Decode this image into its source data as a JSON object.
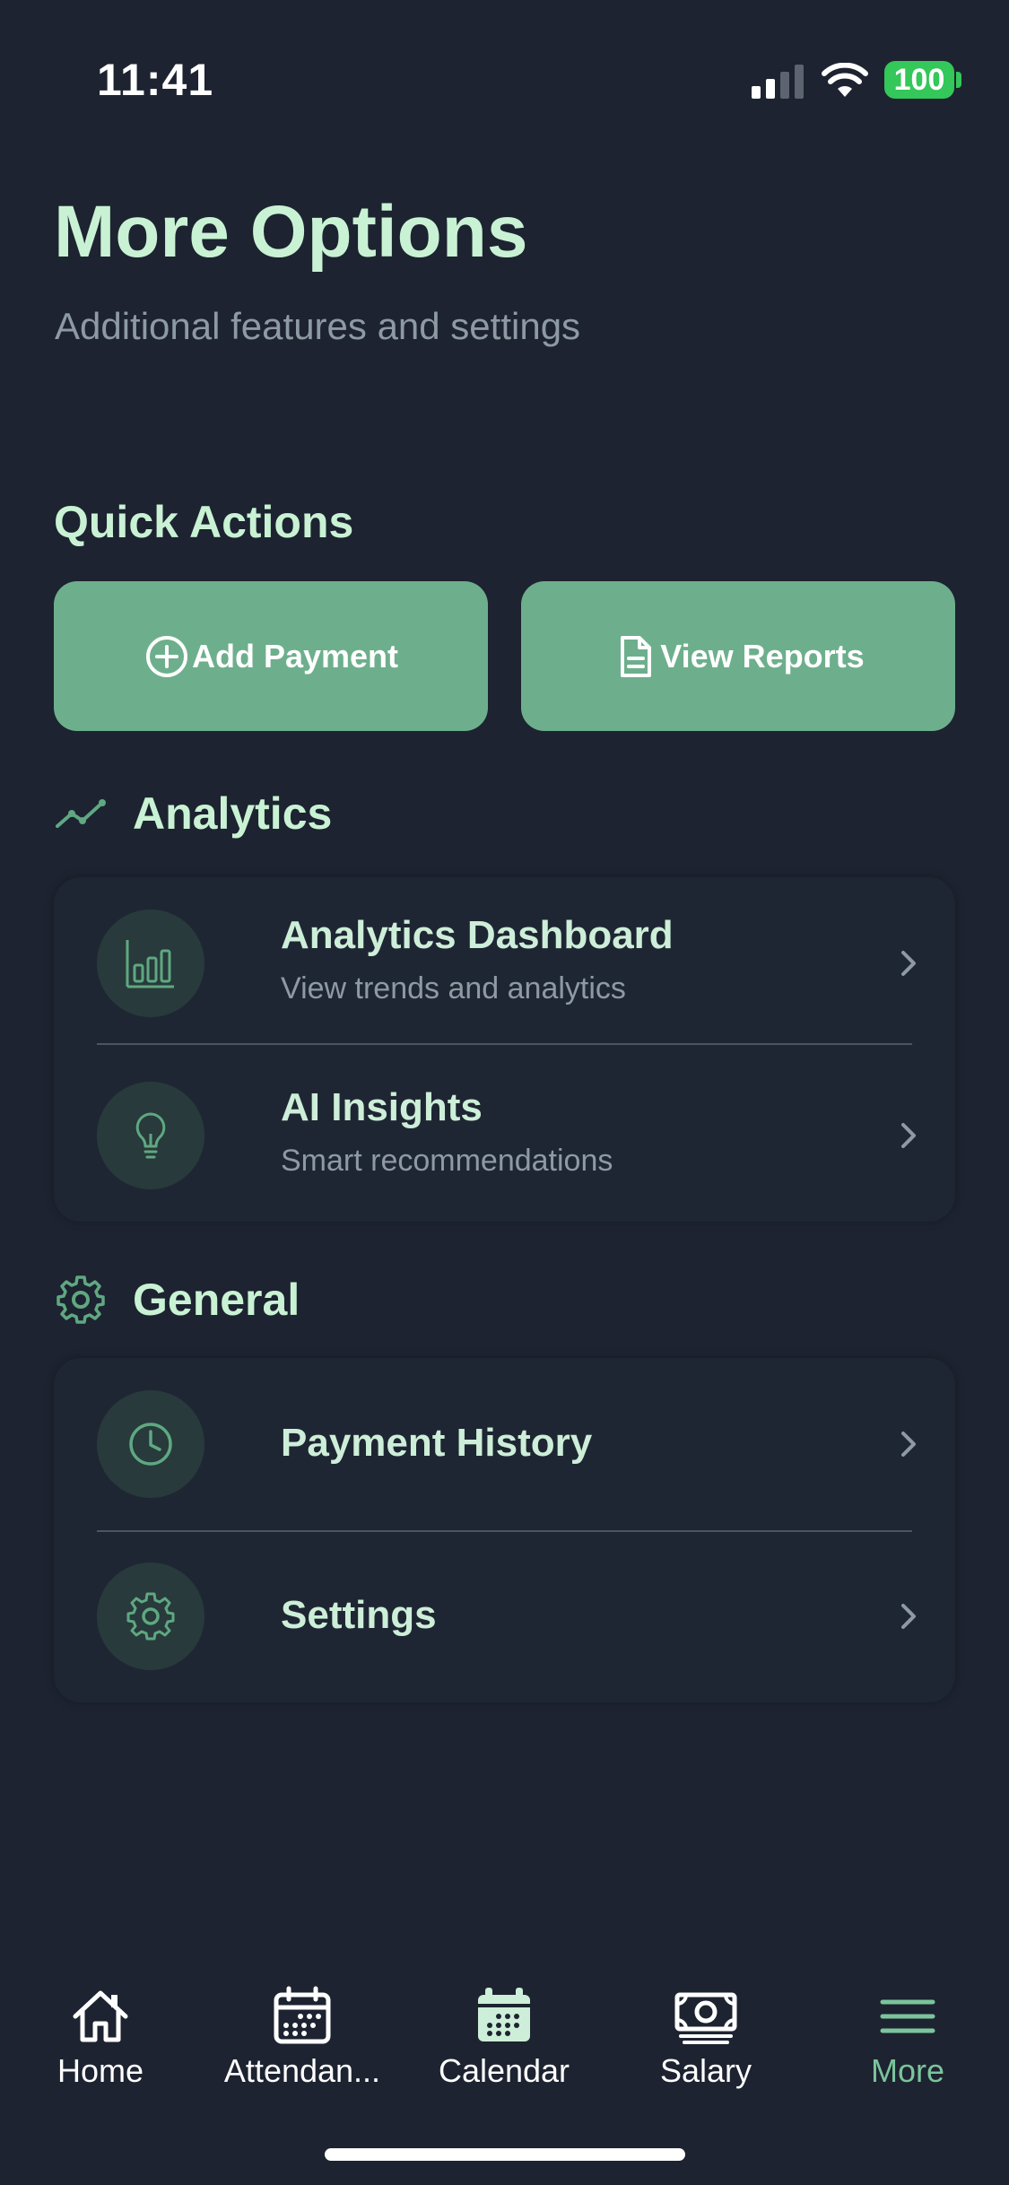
{
  "status_bar": {
    "time": "11:41",
    "battery": "100"
  },
  "header": {
    "title": "More Options",
    "subtitle": "Additional features and settings"
  },
  "quick_actions": {
    "title": "Quick Actions",
    "add_payment": {
      "label": "Add Payment",
      "icon": "plus-circle-icon"
    },
    "view_reports": {
      "label": "View Reports",
      "icon": "document-icon"
    }
  },
  "analytics": {
    "title": "Analytics",
    "icon": "trend-line-icon",
    "items": [
      {
        "title": "Analytics Dashboard",
        "subtitle": "View trends and analytics",
        "icon": "bar-chart-icon"
      },
      {
        "title": "AI Insights",
        "subtitle": "Smart recommendations",
        "icon": "lightbulb-icon"
      }
    ]
  },
  "general": {
    "title": "General",
    "icon": "gear-icon",
    "items": [
      {
        "title": "Payment History",
        "icon": "clock-icon"
      },
      {
        "title": "Settings",
        "icon": "gear-icon"
      }
    ]
  },
  "tab_bar": {
    "tabs": [
      {
        "label": "Home",
        "icon": "home-icon",
        "active": false
      },
      {
        "label": "Attendan...",
        "icon": "calendar-grid-icon",
        "active": false
      },
      {
        "label": "Calendar",
        "icon": "calendar-filled-icon",
        "active": false
      },
      {
        "label": "Salary",
        "icon": "money-icon",
        "active": false
      },
      {
        "label": "More",
        "icon": "menu-icon",
        "active": true
      }
    ]
  },
  "colors": {
    "background": "#1d2330",
    "accent": "#6daf8c",
    "title_text": "#c9f2d4",
    "secondary_text": "#8e9aa3",
    "icon_tint": "#5fa882",
    "active_tab": "#7bc49c"
  }
}
